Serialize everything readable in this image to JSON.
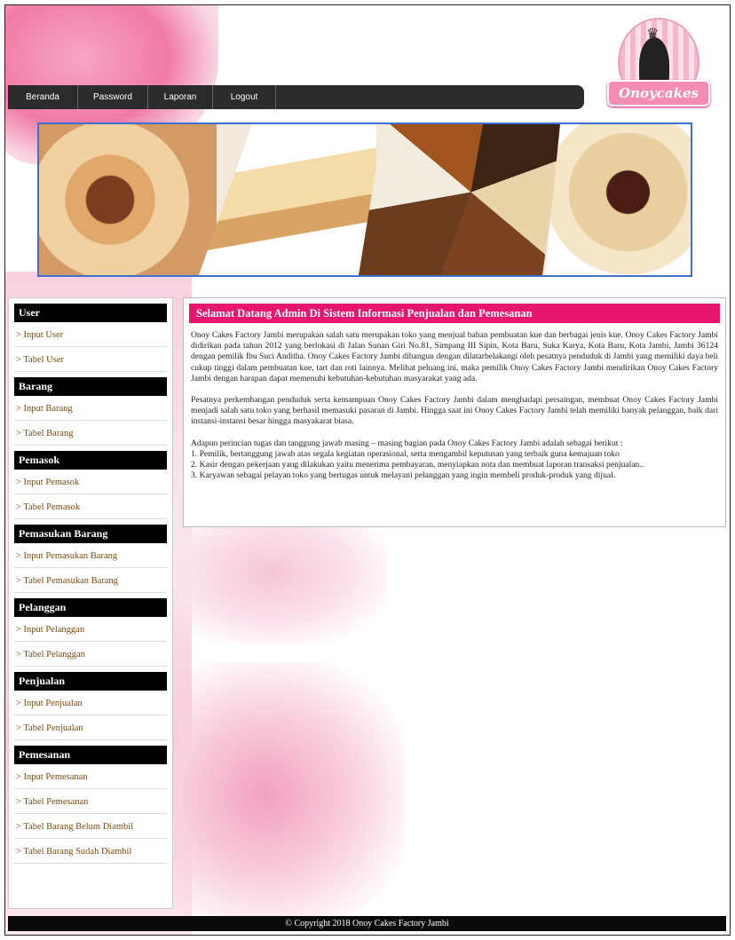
{
  "nav": {
    "items": [
      "Beranda",
      "Password",
      "Laporan",
      "Logout"
    ]
  },
  "logo": {
    "text": "Onoycakes"
  },
  "sidebar": {
    "sections": [
      {
        "title": "User",
        "items": [
          "> Input User",
          "> Tabel User"
        ]
      },
      {
        "title": "Barang",
        "items": [
          "> Input Barang",
          "> Tabel Barang"
        ]
      },
      {
        "title": "Pemasok",
        "items": [
          "> Input Pemasok",
          "> Tabel Pemasok"
        ]
      },
      {
        "title": "Pemasukan Barang",
        "items": [
          "> Input Pemasukan Barang",
          "> Tabel Pemasukan Barang"
        ]
      },
      {
        "title": "Pelanggan",
        "items": [
          "> Input Pelanggan",
          "> Tabel Pelanggan"
        ]
      },
      {
        "title": "Penjualan",
        "items": [
          "> Input Penjualan",
          "> Tabel Penjualan"
        ]
      },
      {
        "title": "Pemesanan",
        "items": [
          "> Input Pemesanan",
          "> Tabel Pemesanan",
          "> Tabel Barang Belum Diambil",
          "> Tabel Barang Sudah Diambil"
        ]
      }
    ]
  },
  "main": {
    "title": "Selamat Datang Admin Di Sistem Informasi Penjualan dan Pemesanan",
    "paragraphs": [
      "Onoy Cakes Factory Jambi merupakan salah satu merupakan toko yang menjual bahan pembuatan kue dan berbagai jenis kue. Onoy Cakes Factory Jambi didirikan pada tahun 2012 yang berlokasi di Jalan Sunan Giri No.81, Simpang III Sipin, Kota Baru, Suka Karya, Kota Baru, Kota Jambi, Jambi 36124 dengan pemilik Ibu Suci Anditha. Onoy Cakes Factory Jambi dibangun dengan dilatarbelakangi oleh pesatnya penduduk di Jambi yang memiliki daya beli cukup tinggi dalam pembuatan kue, tart dan roti lainnya. Melihat peluang ini, maka pemilik Onoy Cakes Factory Jambi mendirikan Onoy Cakes Factory Jambi dengan harapan dapat memenuhi kebutuhan-kebutuhan masyarakat yang ada.",
      "Pesatnya perkembangan penduduk serta kemampuan Onoy Cakes Factory Jambi dalam menghadapi persaingan, membuat Onoy Cakes Factory Jambi menjadi salah satu toko yang berhasil memasuki pasaran di Jambi. Hingga saat ini Onoy Cakes Factory Jambi telah memiliki banyak pelanggan, baik dari instansi-instansi besar hingga masyakarat biasa."
    ],
    "list_intro": "Adapun perincian tugas dan tanggung jawab masing – masing bagian pada Onoy Cakes Factory Jambi adalah sebagai berikut :",
    "list": [
      "1. Pemilik, bertanggung jawab atas segala kegiatan operasional, serta mengambil keputusan yang terbaik guna kemajuan toko",
      "2. Kasir dengan pekerjaan yang dilakukan yaitu menerima pembayaran, menyiapkan nota dan membuat laporan transaksi penjualan..",
      "3. Karyawan sebagai pelayan toko yang bertugas untuk melayani pelanggan yang ingin membeli produk-produk yang dijual."
    ]
  },
  "footer": {
    "text": "© Copyright 2018 Onoy Cakes Factory Jambi"
  },
  "colors": {
    "accent": "#e6166f",
    "nav_bg": "#2b2b2b",
    "banner_border": "#3f6fd0"
  }
}
